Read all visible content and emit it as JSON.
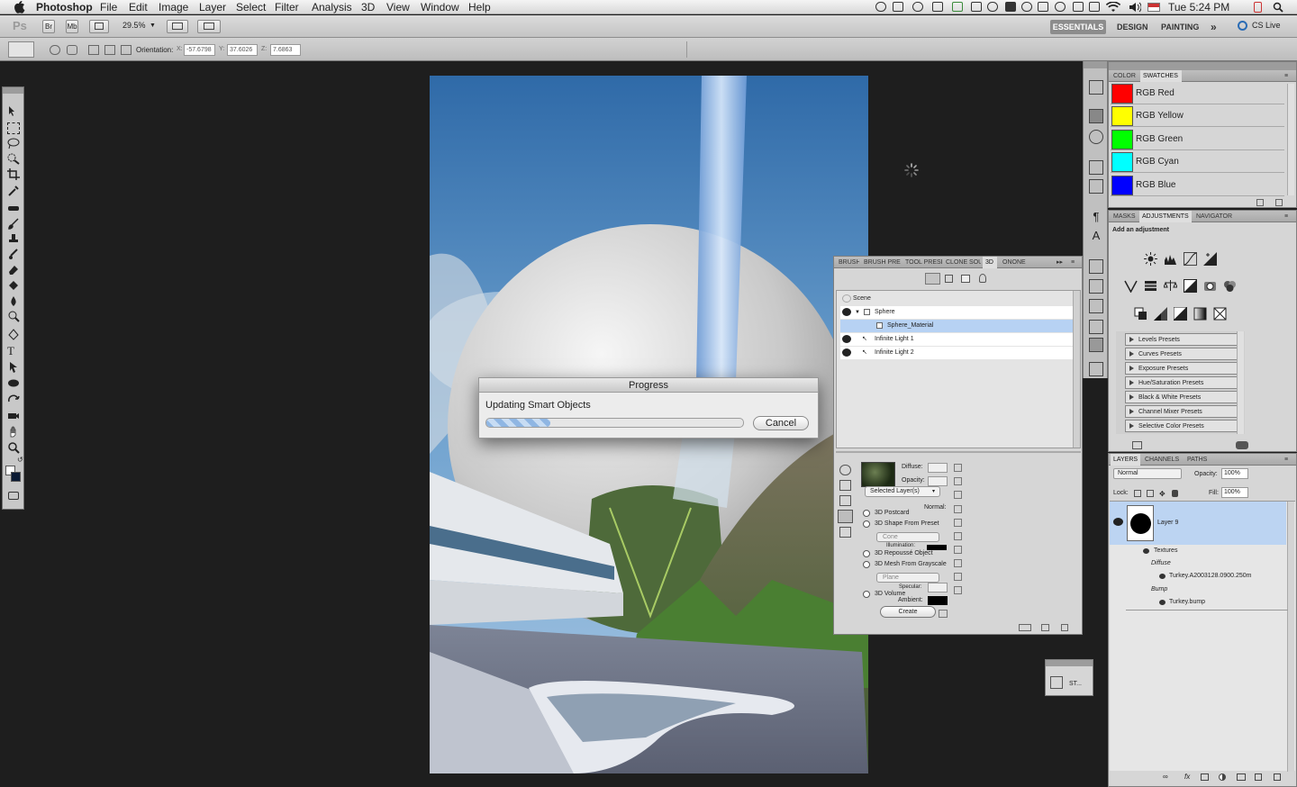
{
  "menubar": {
    "app_name": "Photoshop",
    "items": [
      "File",
      "Edit",
      "Image",
      "Layer",
      "Select",
      "Filter",
      "Analysis",
      "3D",
      "View",
      "Window",
      "Help"
    ],
    "clock": "Tue 5:24 PM"
  },
  "appbar": {
    "ps_logo": "Ps",
    "br_label": "Br",
    "mb_label": "Mb",
    "zoom": "29.5%",
    "workspaces": [
      "ESSENTIALS",
      "DESIGN",
      "PAINTING"
    ],
    "more": "»",
    "cslive": "CS Live"
  },
  "options": {
    "orientation_label": "Orientation:",
    "x_label": "X:",
    "x_value": "-57.6798",
    "y_label": "Y:",
    "y_value": "37.6026",
    "z_label": "Z:",
    "z_value": "7.6863"
  },
  "progress_dialog": {
    "title": "Progress",
    "message": "Updating Smart Objects",
    "progress": 0.25,
    "cancel_label": "Cancel"
  },
  "swatches_panel": {
    "tabs": [
      "COLOR",
      "SWATCHES"
    ],
    "items": [
      {
        "label": "RGB Red",
        "color": "#ff0000"
      },
      {
        "label": "RGB Yellow",
        "color": "#ffff00"
      },
      {
        "label": "RGB Green",
        "color": "#00ff00"
      },
      {
        "label": "RGB Cyan",
        "color": "#00ffff"
      },
      {
        "label": "RGB Blue",
        "color": "#0000ff"
      }
    ]
  },
  "adjustments_panel": {
    "tabs": [
      "MASKS",
      "ADJUSTMENTS",
      "NAVIGATOR"
    ],
    "heading": "Add an adjustment",
    "presets": [
      "Levels Presets",
      "Curves Presets",
      "Exposure Presets",
      "Hue/Saturation Presets",
      "Black & White Presets",
      "Channel Mixer Presets",
      "Selective Color Presets"
    ]
  },
  "layers_panel": {
    "tabs": [
      "LAYERS",
      "CHANNELS",
      "PATHS"
    ],
    "blend_mode": "Normal",
    "opacity_label": "Opacity:",
    "opacity": "100%",
    "lock_label": "Lock:",
    "fill_label": "Fill:",
    "fill": "100%",
    "layer_name": "Layer 9",
    "textures_label": "Textures",
    "diffuse_label": "Diffuse",
    "diffuse_file": "Turkey.A2003128.0900.250m",
    "bump_label": "Bump",
    "bump_file": "Turkey.bump"
  },
  "panel_3d": {
    "tabs": [
      "BRUSH",
      "BRUSH PRES",
      "TOOL PRESE",
      "CLONE SOU",
      "3D",
      "ONONE"
    ],
    "scene_label": "Scene",
    "rows": [
      "Sphere",
      "Sphere_Material",
      "Infinite Light 1",
      "Infinite Light 2"
    ],
    "diffuse_label": "Diffuse:",
    "opacity_label": "Opacity:",
    "source_select": "Selected Layer(s)",
    "normal_label": "Normal:",
    "postcard_label": "3D Postcard",
    "shape_label": "3D Shape From Preset",
    "shape_select": "Cone",
    "illumination_label": "Illumination:",
    "repousse_label": "3D Repoussé Object",
    "mesh_label": "3D Mesh From Grayscale",
    "mesh_select": "Plane",
    "specular_label": "Specular:",
    "volume_label": "3D Volume",
    "ambient_label": "Ambient:",
    "create_label": "Create"
  },
  "mini_panel": {
    "label": "ST..."
  }
}
